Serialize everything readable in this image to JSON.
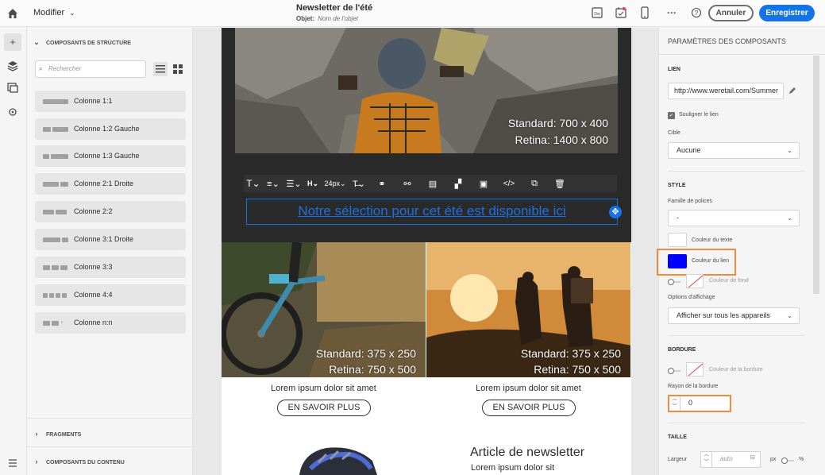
{
  "topbar": {
    "modifier_label": "Modifier",
    "title": "Newsletter de l'été",
    "subject_label": "Objet:",
    "subject_placeholder": "Nom de l'objet",
    "cancel_label": "Annuler",
    "save_label": "Enregistrer",
    "icons": [
      "home-icon",
      "desktop-preview-icon",
      "calendar-icon",
      "mobile-preview-icon",
      "more-icon",
      "help-icon"
    ]
  },
  "left_panel": {
    "structure_heading": "COMPOSANTS DE STRUCTURE",
    "search_placeholder": "Rechercher",
    "components": [
      {
        "label": "Colonne 1:1"
      },
      {
        "label": "Colonne 1:2 Gauche"
      },
      {
        "label": "Colonne 1:3 Gauche"
      },
      {
        "label": "Colonne 2:1 Droite"
      },
      {
        "label": "Colonne 2:2"
      },
      {
        "label": "Colonne 3:1 Droite"
      },
      {
        "label": "Colonne 3:3"
      },
      {
        "label": "Colonne 4:4"
      },
      {
        "label": "Colonne n:n"
      }
    ],
    "fragments_heading": "FRAGMENTS",
    "content_heading": "COMPOSANTS DU CONTENU"
  },
  "email": {
    "hero_label_standard": "Standard: 700 x 400",
    "hero_label_retina": "Retina: 1400 x 800",
    "toolbar": {
      "heading": "H",
      "font_size": "24px"
    },
    "link_text": "Notre sélection pour cet été est disponible ici",
    "left_col": {
      "label_standard": "Standard: 375 x 250",
      "label_retina": "Retina: 750 x 500",
      "caption": "Lorem ipsum dolor sit amet",
      "button": "EN SAVOIR PLUS"
    },
    "right_col": {
      "label_standard": "Standard: 375 x 250",
      "label_retina": "Retina: 750 x 500",
      "caption": "Lorem ipsum dolor sit amet",
      "button": "EN SAVOIR PLUS"
    },
    "article_title": "Article de newsletter",
    "article_sub": "Lorem ipsum dolor sit"
  },
  "right_panel": {
    "title": "PARAMÈTRES DES COMPOSANTS",
    "link_section": "LIEN",
    "link_url": "http://www.weretail.com/Summer",
    "underline_label": "Souligner le lien",
    "target_label": "Cible",
    "target_value": "Aucune",
    "style_section": "STYLE",
    "font_family_label": "Famille de polices",
    "font_family_value": "-",
    "text_color_label": "Couleur du texte",
    "link_color_label": "Couleur du lien",
    "link_color": "#0000ff",
    "bg_color_label": "Couleur de fond",
    "display_label": "Options d'affichage",
    "display_value": "Afficher sur tous les appareils",
    "border_section": "BORDURE",
    "border_color_label": "Couleur de la bordure",
    "radius_label": "Rayon de la bordure",
    "radius_value": "0",
    "size_section": "TAILLE",
    "width_label": "Largeur",
    "width_placeholder": "auto",
    "unit_px": "px",
    "unit_pct": "%"
  }
}
